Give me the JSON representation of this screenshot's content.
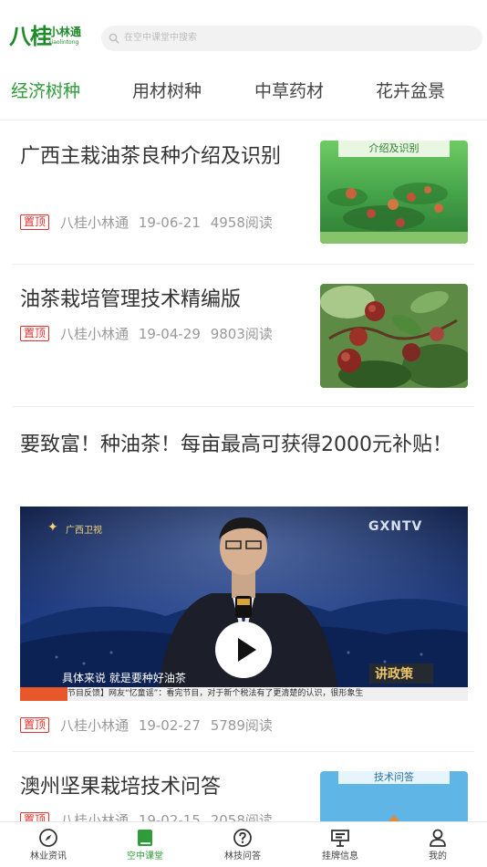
{
  "header": {
    "logo_main": "八桂",
    "logo_sub": "小林通",
    "logo_en": "xiaolintong",
    "search_placeholder": "在空中课堂中搜索"
  },
  "tabs": [
    {
      "label": "经济树种",
      "active": true
    },
    {
      "label": "用材树种",
      "active": false
    },
    {
      "label": "中草药材",
      "active": false
    },
    {
      "label": "花卉盆景",
      "active": false
    }
  ],
  "articles": [
    {
      "title": "广西主栽油茶良种介绍及识别",
      "badge": "置顶",
      "source": "八桂小林通",
      "date": "19-06-21",
      "reads": "4958阅读",
      "thumb_caption": "介绍及识别"
    },
    {
      "title": "油茶栽培管理技术精编版",
      "badge": "置顶",
      "source": "八桂小林通",
      "date": "19-04-29",
      "reads": "9803阅读"
    },
    {
      "title": "要致富！种油茶！每亩最高可获得2000元补贴！",
      "badge": "置顶",
      "source": "八桂小林通",
      "date": "19-02-27",
      "reads": "5789阅读",
      "video": {
        "channel_logo": "广西卫视",
        "channel_badge": "GXNTV",
        "caption": "具体来说 就是要种好油茶",
        "ticker": "节目反馈】网友“忆童谣”：看完节目，对于新个税法有了更清楚的认识，很形象生",
        "program": "讲政策",
        "mic_label": "讲政策"
      }
    },
    {
      "title": "澳州坚果栽培技术问答",
      "badge": "置顶",
      "source": "八桂小林通",
      "date": "19-02-15",
      "reads": "2058阅读",
      "thumb_caption": "技术问答"
    }
  ],
  "tabbar": [
    {
      "label": "林业资讯",
      "icon": "compass-icon",
      "active": false
    },
    {
      "label": "空中课堂",
      "icon": "book-icon",
      "active": true
    },
    {
      "label": "林技问答",
      "icon": "question-icon",
      "active": false
    },
    {
      "label": "挂牌信息",
      "icon": "signboard-icon",
      "active": false
    },
    {
      "label": "我的",
      "icon": "user-icon",
      "active": false
    }
  ],
  "colors": {
    "accent": "#2f9b3a",
    "badge": "#e0312d",
    "text": "#333333",
    "meta": "#999999"
  }
}
